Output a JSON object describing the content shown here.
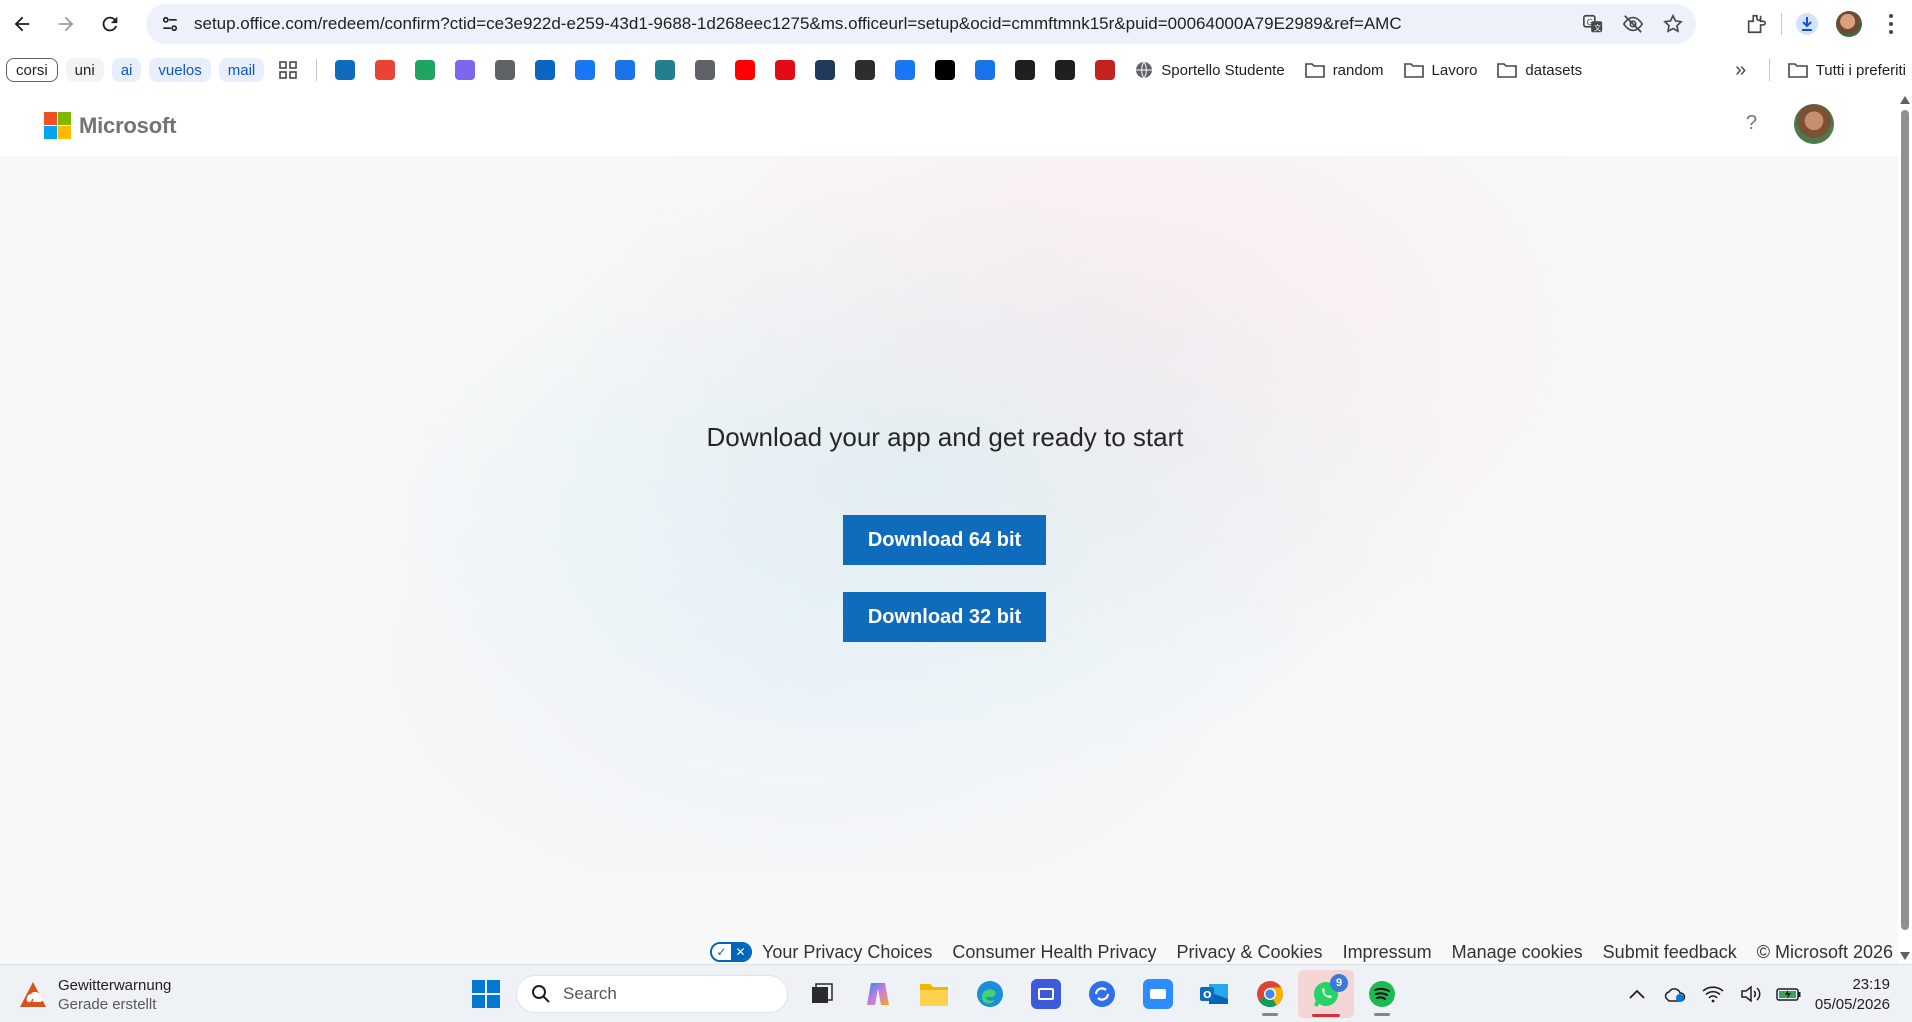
{
  "browser": {
    "url": "setup.office.com/redeem/confirm?ctid=ce3e922d-e259-43d1-9688-1d268eec1275&ms.officeurl=setup&ocid=cmmftmnk15r&puid=00064000A79E2989&ref=AMC"
  },
  "bookmarks": {
    "chips": [
      {
        "label": "corsi",
        "style": "grey"
      },
      {
        "label": "uni",
        "style": "plain"
      },
      {
        "label": "ai",
        "style": "blue"
      },
      {
        "label": "vuelos",
        "style": "blue"
      },
      {
        "label": "mail",
        "style": "blue"
      }
    ],
    "icons": [
      {
        "name": "outlook-icon",
        "color": "#0f6cbd"
      },
      {
        "name": "gmail-icon",
        "color": "#ea4335"
      },
      {
        "name": "drive-icon",
        "color": "#1fa463"
      },
      {
        "name": "clickup-icon",
        "color": "#7b68ee"
      },
      {
        "name": "globe-icon",
        "color": "#5f6368"
      },
      {
        "name": "linkedin-icon",
        "color": "#0a66c2"
      },
      {
        "name": "facebook-icon",
        "color": "#1877f2"
      },
      {
        "name": "calendar-icon",
        "color": "#1a73e8"
      },
      {
        "name": "perplexity-icon",
        "color": "#20808d"
      },
      {
        "name": "image-icon",
        "color": "#5f6368"
      },
      {
        "name": "youtube-icon",
        "color": "#ff0000"
      },
      {
        "name": "netflix-icon",
        "color": "#e50914"
      },
      {
        "name": "hex-icon",
        "color": "#1f3a5a"
      },
      {
        "name": "lion-icon",
        "color": "#2d2d2d"
      },
      {
        "name": "messenger-icon",
        "color": "#1877f2"
      },
      {
        "name": "x-icon",
        "color": "#000000"
      },
      {
        "name": "bolt-icon",
        "color": "#1a73e8"
      },
      {
        "name": "record-icon",
        "color": "#1f1f1f"
      },
      {
        "name": "openai-icon",
        "color": "#1f1f1f"
      },
      {
        "name": "inbox-icon",
        "color": "#c5221f"
      }
    ],
    "sportello": "Sportello Studente",
    "folders": [
      "random",
      "Lavoro",
      "datasets"
    ],
    "all_bookmarks": "Tutti i preferiti"
  },
  "ms": {
    "logo_text": "Microsoft",
    "help": "?",
    "headline": "Download your app and get ready to start",
    "btn_64": "Download 64 bit",
    "btn_32": "Download 32 bit",
    "colors": {
      "button": "#0f6cbd"
    }
  },
  "footer": {
    "privacy_choices": "Your Privacy Choices",
    "consumer_health": "Consumer Health Privacy",
    "privacy_cookies": "Privacy & Cookies",
    "impressum": "Impressum",
    "manage_cookies": "Manage cookies",
    "submit_feedback": "Submit feedback",
    "copyright": "© Microsoft 2026"
  },
  "taskbar": {
    "weather_title": "Gewitterwarnung",
    "weather_sub": "Gerade erstellt",
    "search_placeholder": "Search",
    "whatsapp_badge": "9",
    "time": "23:19",
    "date": "05/05/2026"
  }
}
